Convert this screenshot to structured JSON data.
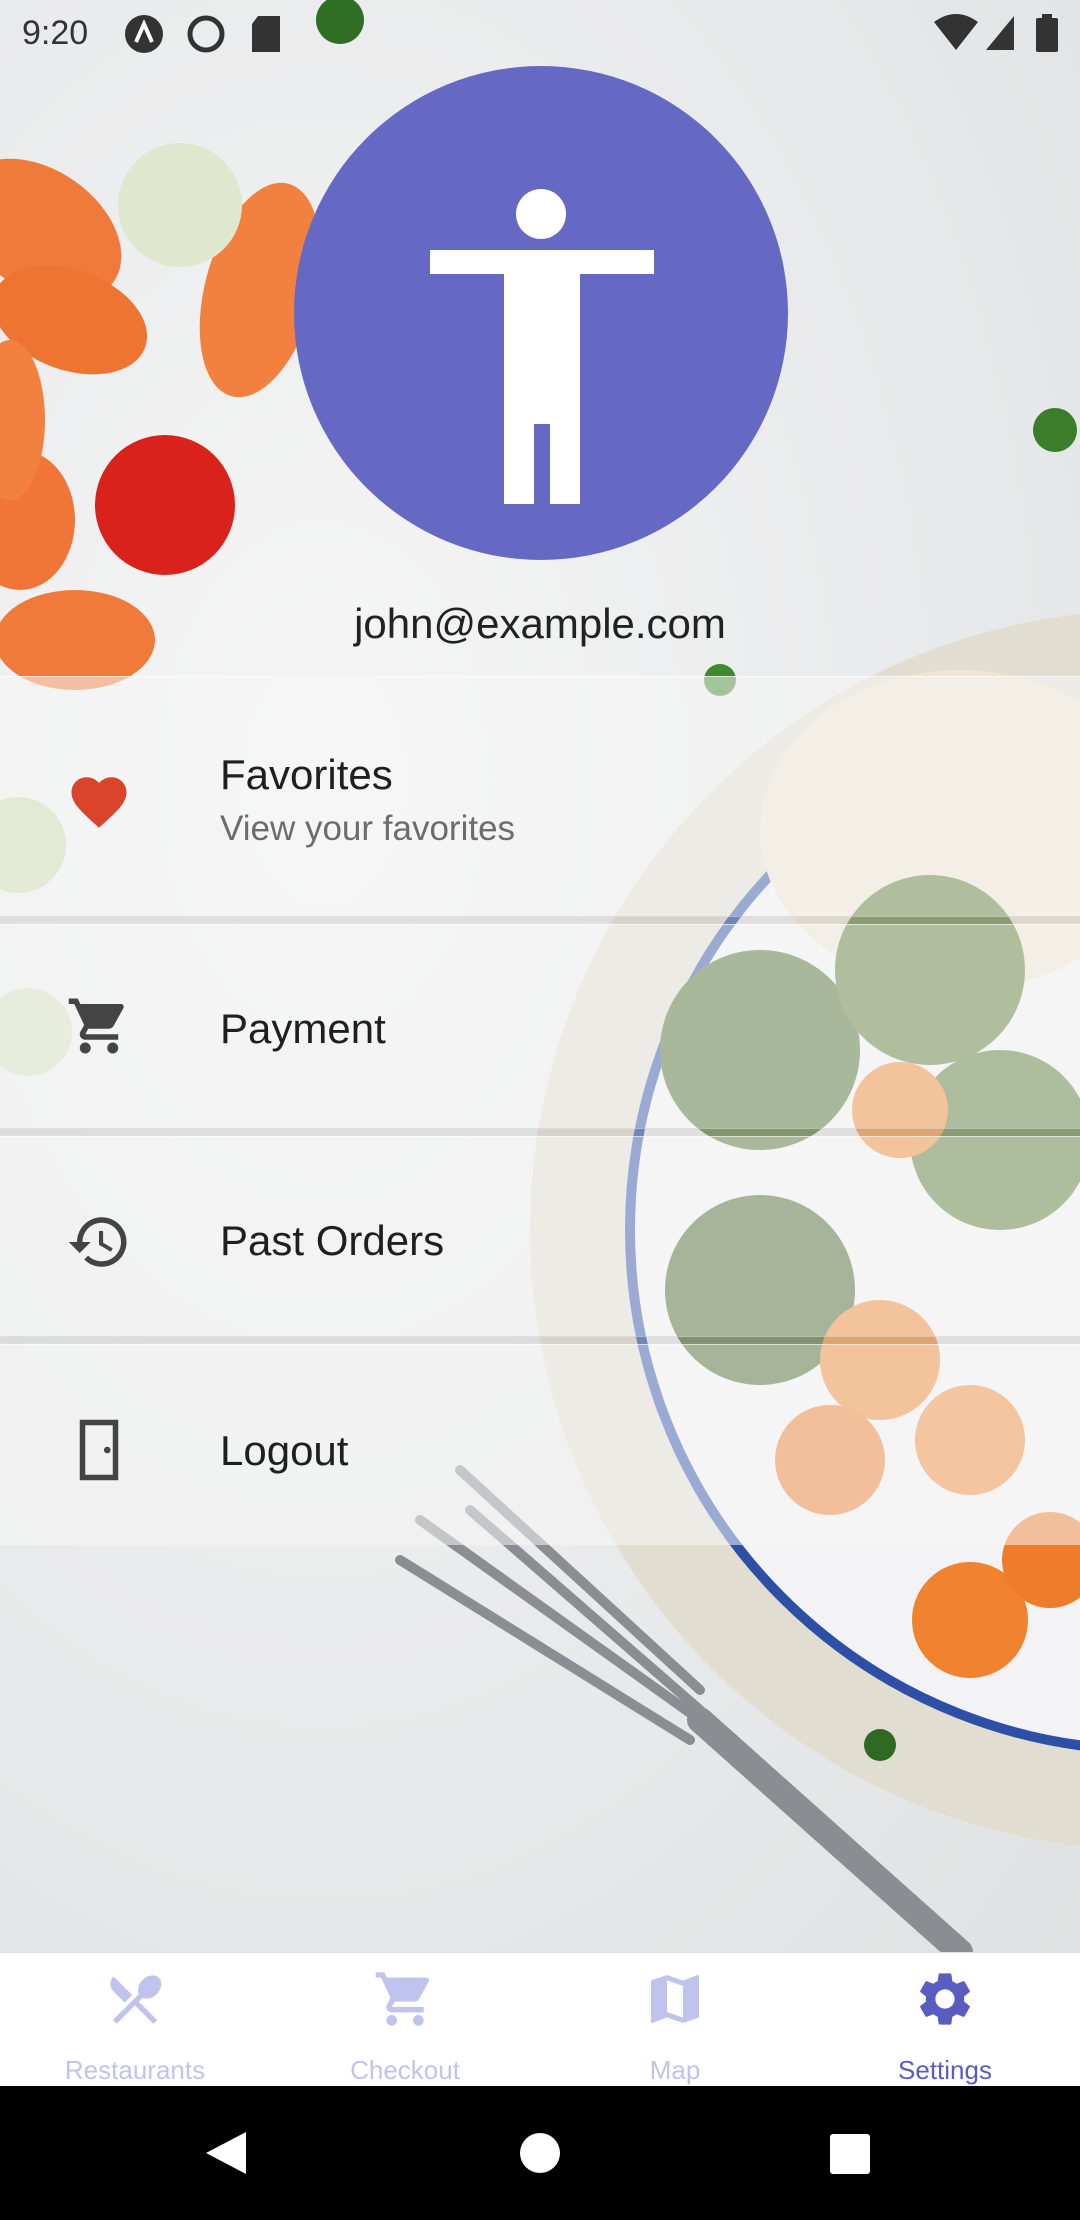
{
  "status_bar": {
    "time": "9:20",
    "icons": [
      "a-icon",
      "vpn-icon",
      "sd-card-icon",
      "wifi-icon",
      "signal-icon",
      "battery-icon"
    ]
  },
  "profile": {
    "avatar_icon": "accessibility-person-icon",
    "avatar_color": "#6669C4",
    "email": "john@example.com"
  },
  "menu": {
    "items": [
      {
        "title": "Favorites",
        "subtitle": "View your favorites",
        "icon": "heart-icon",
        "icon_color": "#D9442B"
      },
      {
        "title": "Payment",
        "icon": "cart-icon"
      },
      {
        "title": "Past Orders",
        "icon": "history-icon"
      },
      {
        "title": "Logout",
        "icon": "door-icon"
      }
    ]
  },
  "bottom_nav": {
    "items": [
      {
        "label": "Restaurants",
        "icon": "restaurant-icon",
        "active": false
      },
      {
        "label": "Checkout",
        "icon": "cart-icon",
        "active": false
      },
      {
        "label": "Map",
        "icon": "map-icon",
        "active": false
      },
      {
        "label": "Settings",
        "icon": "gear-icon",
        "active": true
      }
    ],
    "active_color": "#5A5DC0",
    "inactive_color": "#BFC3EE"
  },
  "system_nav": {
    "icons": [
      "back-icon",
      "home-icon",
      "recents-icon"
    ]
  }
}
